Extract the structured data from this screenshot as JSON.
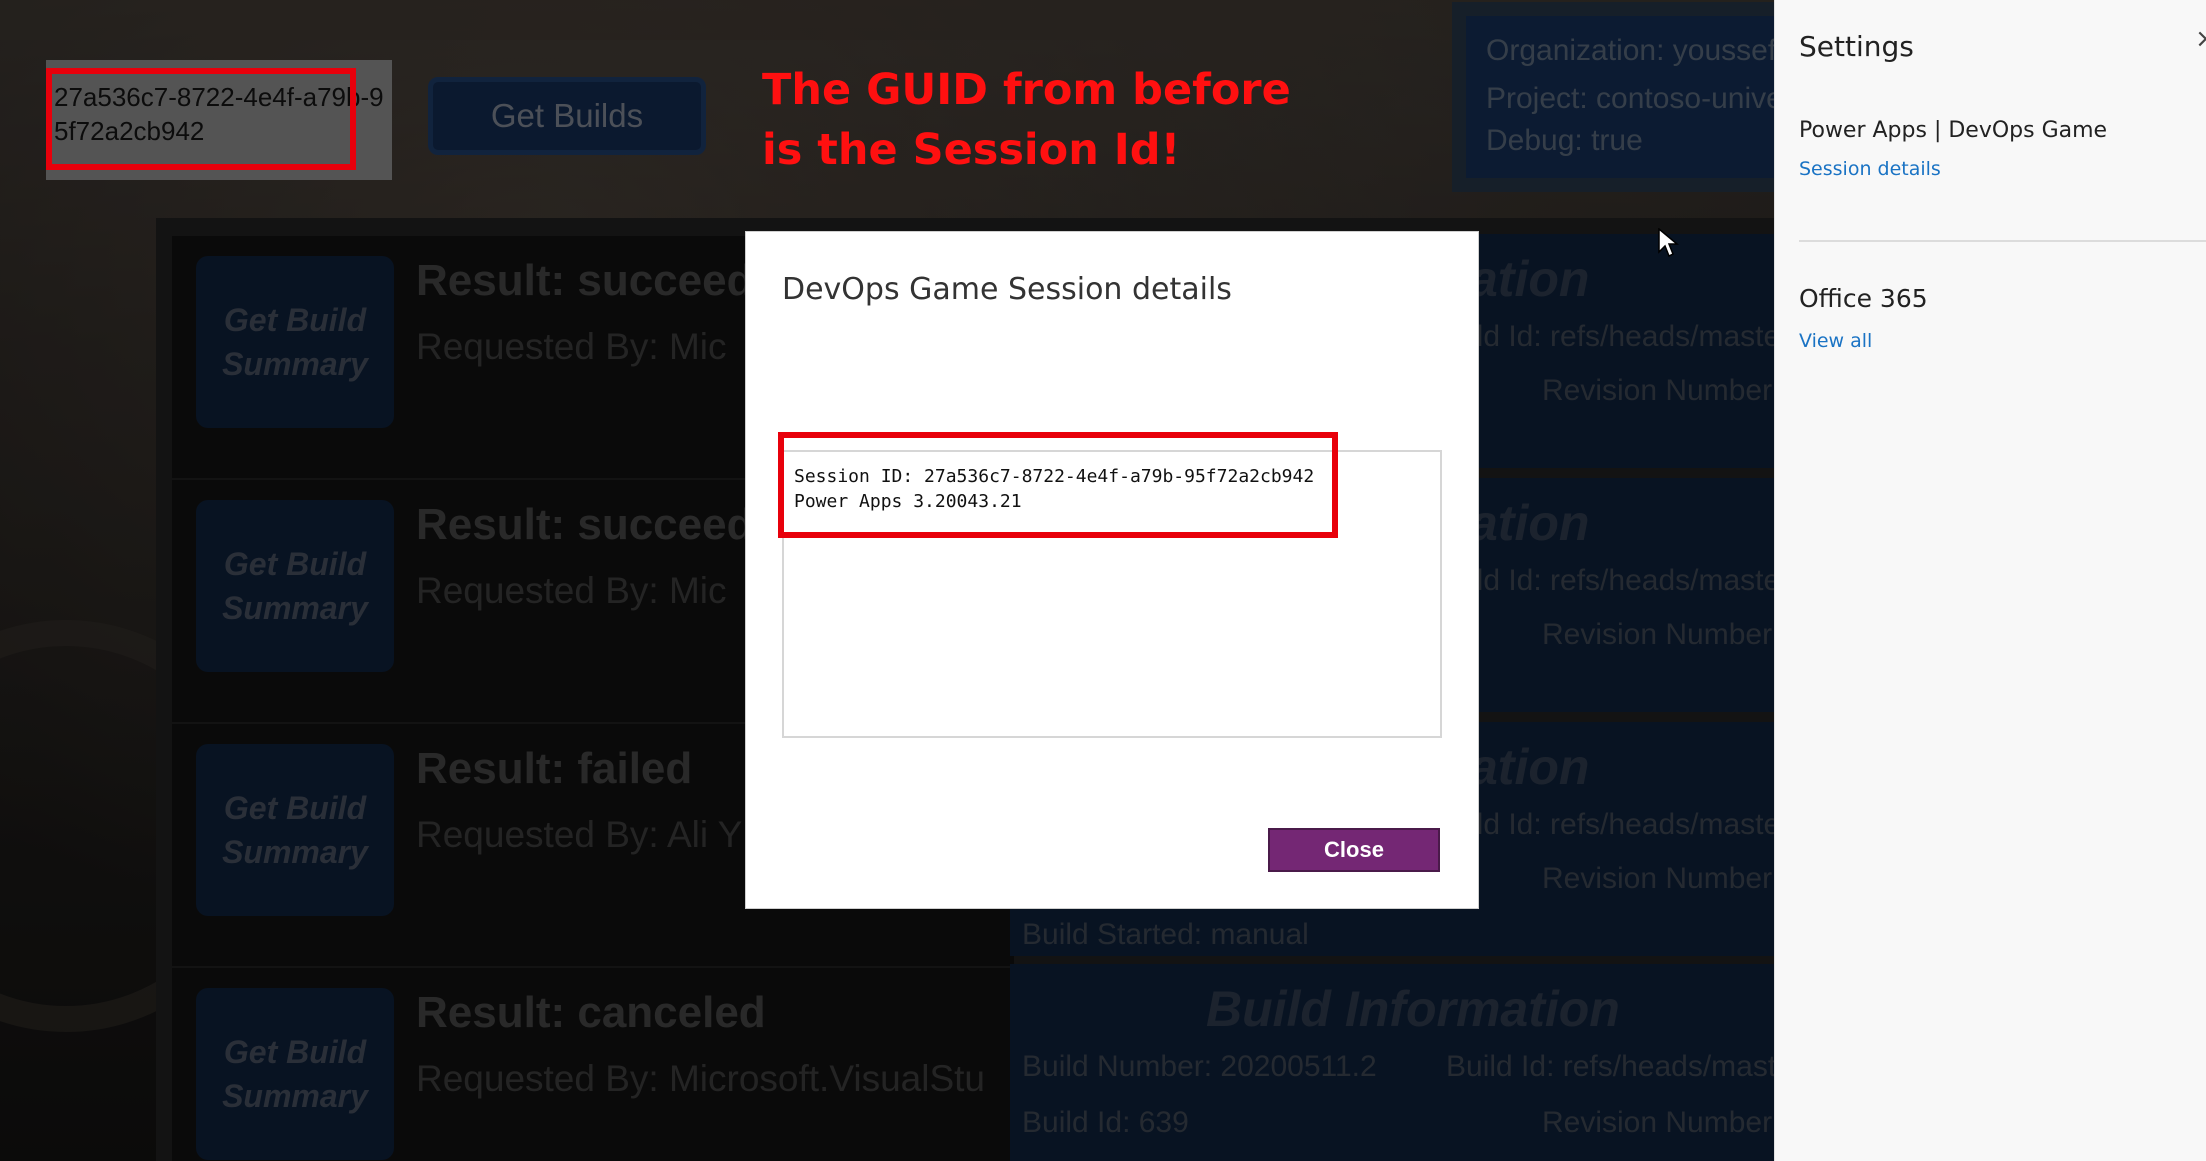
{
  "background": {
    "guid_text": "27a536c7-8722-4e4f-a79b-95f72a2cb942",
    "get_builds_label": "Get Builds",
    "callout_line1": "The GUID from before",
    "callout_line2": "is the Session Id!",
    "org_panel": {
      "organization": "Organization: youssefi",
      "project": "Project: contoso-univer",
      "debug": "Debug: true"
    },
    "rows": [
      {
        "button": "Get Build Summary",
        "result": "Result: succeede",
        "requested": "Requested By: Mic"
      },
      {
        "button": "Get Build Summary",
        "result": "Result: succeede",
        "requested": "Requested By: Mic"
      },
      {
        "button": "Get Build Summary",
        "result": "Result: failed",
        "requested": "Requested By: Ali Y"
      },
      {
        "button": "Get Build Summary",
        "result": "Result: canceled",
        "requested": "Requested By: Microsoft.VisualStu"
      }
    ],
    "info_panels": [
      {
        "title": "ation",
        "build_id": "ild Id: refs/heads/maste",
        "revision": "Revision Number:"
      },
      {
        "title": "ation",
        "build_id": "ild Id: refs/heads/maste",
        "revision": "Revision Number:"
      },
      {
        "title": "ation",
        "build_id": "ild Id: refs/heads/maste",
        "revision": "Revision Number:",
        "started": "Build Started: manual"
      },
      {
        "title": "Build Information",
        "build_number": "Build Number: 20200511.2",
        "build_id": "Build Id: refs/heads/maste",
        "build_id_num": "Build Id: 639",
        "revision": "Revision Number:"
      }
    ]
  },
  "modal": {
    "title": "DevOps Game Session details",
    "details_text": "Session ID: 27a536c7-8722-4e4f-a79b-95f72a2cb942\nPower Apps 3.20043.21",
    "close_label": "Close"
  },
  "settings": {
    "title": "Settings",
    "close_glyph": "×",
    "app_line": "Power Apps  |  DevOps Game",
    "session_details_link": "Session details",
    "office_heading": "Office 365",
    "view_all_link": "View all"
  },
  "colors": {
    "accent_purple": "#742774",
    "highlight_red": "#e8000b",
    "tile_blue": "#1c3f73",
    "link_blue": "#1a73c4"
  }
}
